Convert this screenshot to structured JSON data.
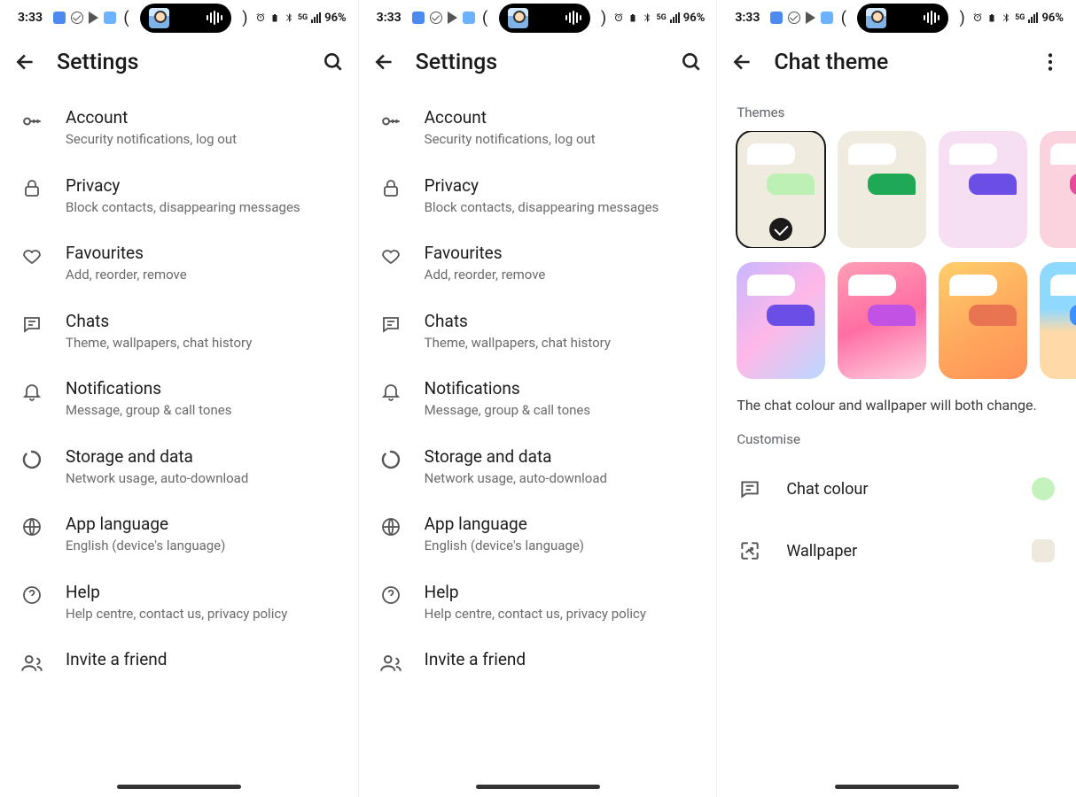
{
  "status": {
    "time": "3:33",
    "battery": "96%"
  },
  "settings": {
    "title": "Settings",
    "items": [
      {
        "title": "Account",
        "subtitle": "Security notifications, log out"
      },
      {
        "title": "Privacy",
        "subtitle": "Block contacts, disappearing messages"
      },
      {
        "title": "Favourites",
        "subtitle": "Add, reorder, remove"
      },
      {
        "title": "Chats",
        "subtitle": "Theme, wallpapers, chat history"
      },
      {
        "title": "Notifications",
        "subtitle": "Message, group & call tones"
      },
      {
        "title": "Storage and data",
        "subtitle": "Network usage, auto-download"
      },
      {
        "title": "App language",
        "subtitle": "English (device's language)"
      },
      {
        "title": "Help",
        "subtitle": "Help centre, contact us, privacy policy"
      },
      {
        "title": "Invite a friend",
        "subtitle": ""
      }
    ]
  },
  "chatTheme": {
    "title": "Chat theme",
    "sectionThemes": "Themes",
    "hint": "The chat colour and wallpaper will both change.",
    "sectionCustomise": "Customise",
    "chatColourLabel": "Chat colour",
    "wallpaperLabel": "Wallpaper",
    "themes": [
      {
        "bg": "#efebdf",
        "out": "#bdf0b5",
        "selected": true
      },
      {
        "bg": "#efebdf",
        "out": "#1fa855",
        "selected": false
      },
      {
        "bg": "#f6dff2",
        "out": "#6b4ee6",
        "selected": false
      },
      {
        "bg": "#fbd3df",
        "out": "#e84a9a",
        "selected": false
      },
      {
        "bg": "linear-gradient(135deg,#c9b6ff,#ffb8e8,#b8d9ff)",
        "out": "#6b4ee6",
        "selected": false
      },
      {
        "bg": "linear-gradient(160deg,#ff9fb5,#ff6ea3,#ffd1e2)",
        "out": "#c152e3",
        "selected": false
      },
      {
        "bg": "linear-gradient(150deg,#ffcf6b,#ffab5e,#ff8f57)",
        "out": "#e97452",
        "selected": false
      },
      {
        "bg": "linear-gradient(180deg,#8fd9ff 40%,#ffd9a8 60%)",
        "out": "#3b8fff",
        "selected": false
      }
    ],
    "chatColourSwatch": "#c3f2bd",
    "wallpaperSwatch": "#efe8dc"
  }
}
